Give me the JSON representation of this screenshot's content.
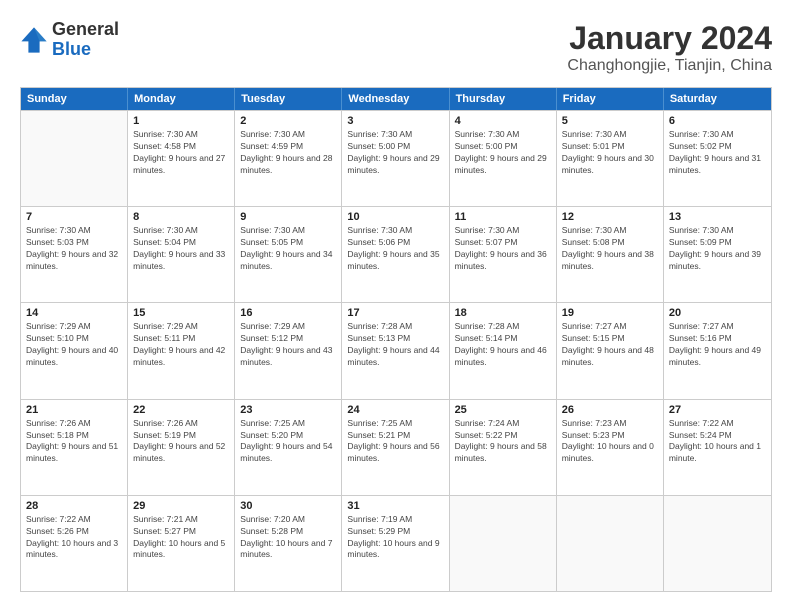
{
  "logo": {
    "general": "General",
    "blue": "Blue",
    "tagline": ""
  },
  "title": "January 2024",
  "subtitle": "Changhongjie, Tianjin, China",
  "weekdays": [
    "Sunday",
    "Monday",
    "Tuesday",
    "Wednesday",
    "Thursday",
    "Friday",
    "Saturday"
  ],
  "weeks": [
    [
      {
        "day": "",
        "empty": true
      },
      {
        "day": "1",
        "sunrise": "Sunrise: 7:30 AM",
        "sunset": "Sunset: 4:58 PM",
        "daylight": "Daylight: 9 hours and 27 minutes."
      },
      {
        "day": "2",
        "sunrise": "Sunrise: 7:30 AM",
        "sunset": "Sunset: 4:59 PM",
        "daylight": "Daylight: 9 hours and 28 minutes."
      },
      {
        "day": "3",
        "sunrise": "Sunrise: 7:30 AM",
        "sunset": "Sunset: 5:00 PM",
        "daylight": "Daylight: 9 hours and 29 minutes."
      },
      {
        "day": "4",
        "sunrise": "Sunrise: 7:30 AM",
        "sunset": "Sunset: 5:00 PM",
        "daylight": "Daylight: 9 hours and 29 minutes."
      },
      {
        "day": "5",
        "sunrise": "Sunrise: 7:30 AM",
        "sunset": "Sunset: 5:01 PM",
        "daylight": "Daylight: 9 hours and 30 minutes."
      },
      {
        "day": "6",
        "sunrise": "Sunrise: 7:30 AM",
        "sunset": "Sunset: 5:02 PM",
        "daylight": "Daylight: 9 hours and 31 minutes."
      }
    ],
    [
      {
        "day": "7",
        "sunrise": "Sunrise: 7:30 AM",
        "sunset": "Sunset: 5:03 PM",
        "daylight": "Daylight: 9 hours and 32 minutes."
      },
      {
        "day": "8",
        "sunrise": "Sunrise: 7:30 AM",
        "sunset": "Sunset: 5:04 PM",
        "daylight": "Daylight: 9 hours and 33 minutes."
      },
      {
        "day": "9",
        "sunrise": "Sunrise: 7:30 AM",
        "sunset": "Sunset: 5:05 PM",
        "daylight": "Daylight: 9 hours and 34 minutes."
      },
      {
        "day": "10",
        "sunrise": "Sunrise: 7:30 AM",
        "sunset": "Sunset: 5:06 PM",
        "daylight": "Daylight: 9 hours and 35 minutes."
      },
      {
        "day": "11",
        "sunrise": "Sunrise: 7:30 AM",
        "sunset": "Sunset: 5:07 PM",
        "daylight": "Daylight: 9 hours and 36 minutes."
      },
      {
        "day": "12",
        "sunrise": "Sunrise: 7:30 AM",
        "sunset": "Sunset: 5:08 PM",
        "daylight": "Daylight: 9 hours and 38 minutes."
      },
      {
        "day": "13",
        "sunrise": "Sunrise: 7:30 AM",
        "sunset": "Sunset: 5:09 PM",
        "daylight": "Daylight: 9 hours and 39 minutes."
      }
    ],
    [
      {
        "day": "14",
        "sunrise": "Sunrise: 7:29 AM",
        "sunset": "Sunset: 5:10 PM",
        "daylight": "Daylight: 9 hours and 40 minutes."
      },
      {
        "day": "15",
        "sunrise": "Sunrise: 7:29 AM",
        "sunset": "Sunset: 5:11 PM",
        "daylight": "Daylight: 9 hours and 42 minutes."
      },
      {
        "day": "16",
        "sunrise": "Sunrise: 7:29 AM",
        "sunset": "Sunset: 5:12 PM",
        "daylight": "Daylight: 9 hours and 43 minutes."
      },
      {
        "day": "17",
        "sunrise": "Sunrise: 7:28 AM",
        "sunset": "Sunset: 5:13 PM",
        "daylight": "Daylight: 9 hours and 44 minutes."
      },
      {
        "day": "18",
        "sunrise": "Sunrise: 7:28 AM",
        "sunset": "Sunset: 5:14 PM",
        "daylight": "Daylight: 9 hours and 46 minutes."
      },
      {
        "day": "19",
        "sunrise": "Sunrise: 7:27 AM",
        "sunset": "Sunset: 5:15 PM",
        "daylight": "Daylight: 9 hours and 48 minutes."
      },
      {
        "day": "20",
        "sunrise": "Sunrise: 7:27 AM",
        "sunset": "Sunset: 5:16 PM",
        "daylight": "Daylight: 9 hours and 49 minutes."
      }
    ],
    [
      {
        "day": "21",
        "sunrise": "Sunrise: 7:26 AM",
        "sunset": "Sunset: 5:18 PM",
        "daylight": "Daylight: 9 hours and 51 minutes."
      },
      {
        "day": "22",
        "sunrise": "Sunrise: 7:26 AM",
        "sunset": "Sunset: 5:19 PM",
        "daylight": "Daylight: 9 hours and 52 minutes."
      },
      {
        "day": "23",
        "sunrise": "Sunrise: 7:25 AM",
        "sunset": "Sunset: 5:20 PM",
        "daylight": "Daylight: 9 hours and 54 minutes."
      },
      {
        "day": "24",
        "sunrise": "Sunrise: 7:25 AM",
        "sunset": "Sunset: 5:21 PM",
        "daylight": "Daylight: 9 hours and 56 minutes."
      },
      {
        "day": "25",
        "sunrise": "Sunrise: 7:24 AM",
        "sunset": "Sunset: 5:22 PM",
        "daylight": "Daylight: 9 hours and 58 minutes."
      },
      {
        "day": "26",
        "sunrise": "Sunrise: 7:23 AM",
        "sunset": "Sunset: 5:23 PM",
        "daylight": "Daylight: 10 hours and 0 minutes."
      },
      {
        "day": "27",
        "sunrise": "Sunrise: 7:22 AM",
        "sunset": "Sunset: 5:24 PM",
        "daylight": "Daylight: 10 hours and 1 minute."
      }
    ],
    [
      {
        "day": "28",
        "sunrise": "Sunrise: 7:22 AM",
        "sunset": "Sunset: 5:26 PM",
        "daylight": "Daylight: 10 hours and 3 minutes."
      },
      {
        "day": "29",
        "sunrise": "Sunrise: 7:21 AM",
        "sunset": "Sunset: 5:27 PM",
        "daylight": "Daylight: 10 hours and 5 minutes."
      },
      {
        "day": "30",
        "sunrise": "Sunrise: 7:20 AM",
        "sunset": "Sunset: 5:28 PM",
        "daylight": "Daylight: 10 hours and 7 minutes."
      },
      {
        "day": "31",
        "sunrise": "Sunrise: 7:19 AM",
        "sunset": "Sunset: 5:29 PM",
        "daylight": "Daylight: 10 hours and 9 minutes."
      },
      {
        "day": "",
        "empty": true
      },
      {
        "day": "",
        "empty": true
      },
      {
        "day": "",
        "empty": true
      }
    ]
  ]
}
